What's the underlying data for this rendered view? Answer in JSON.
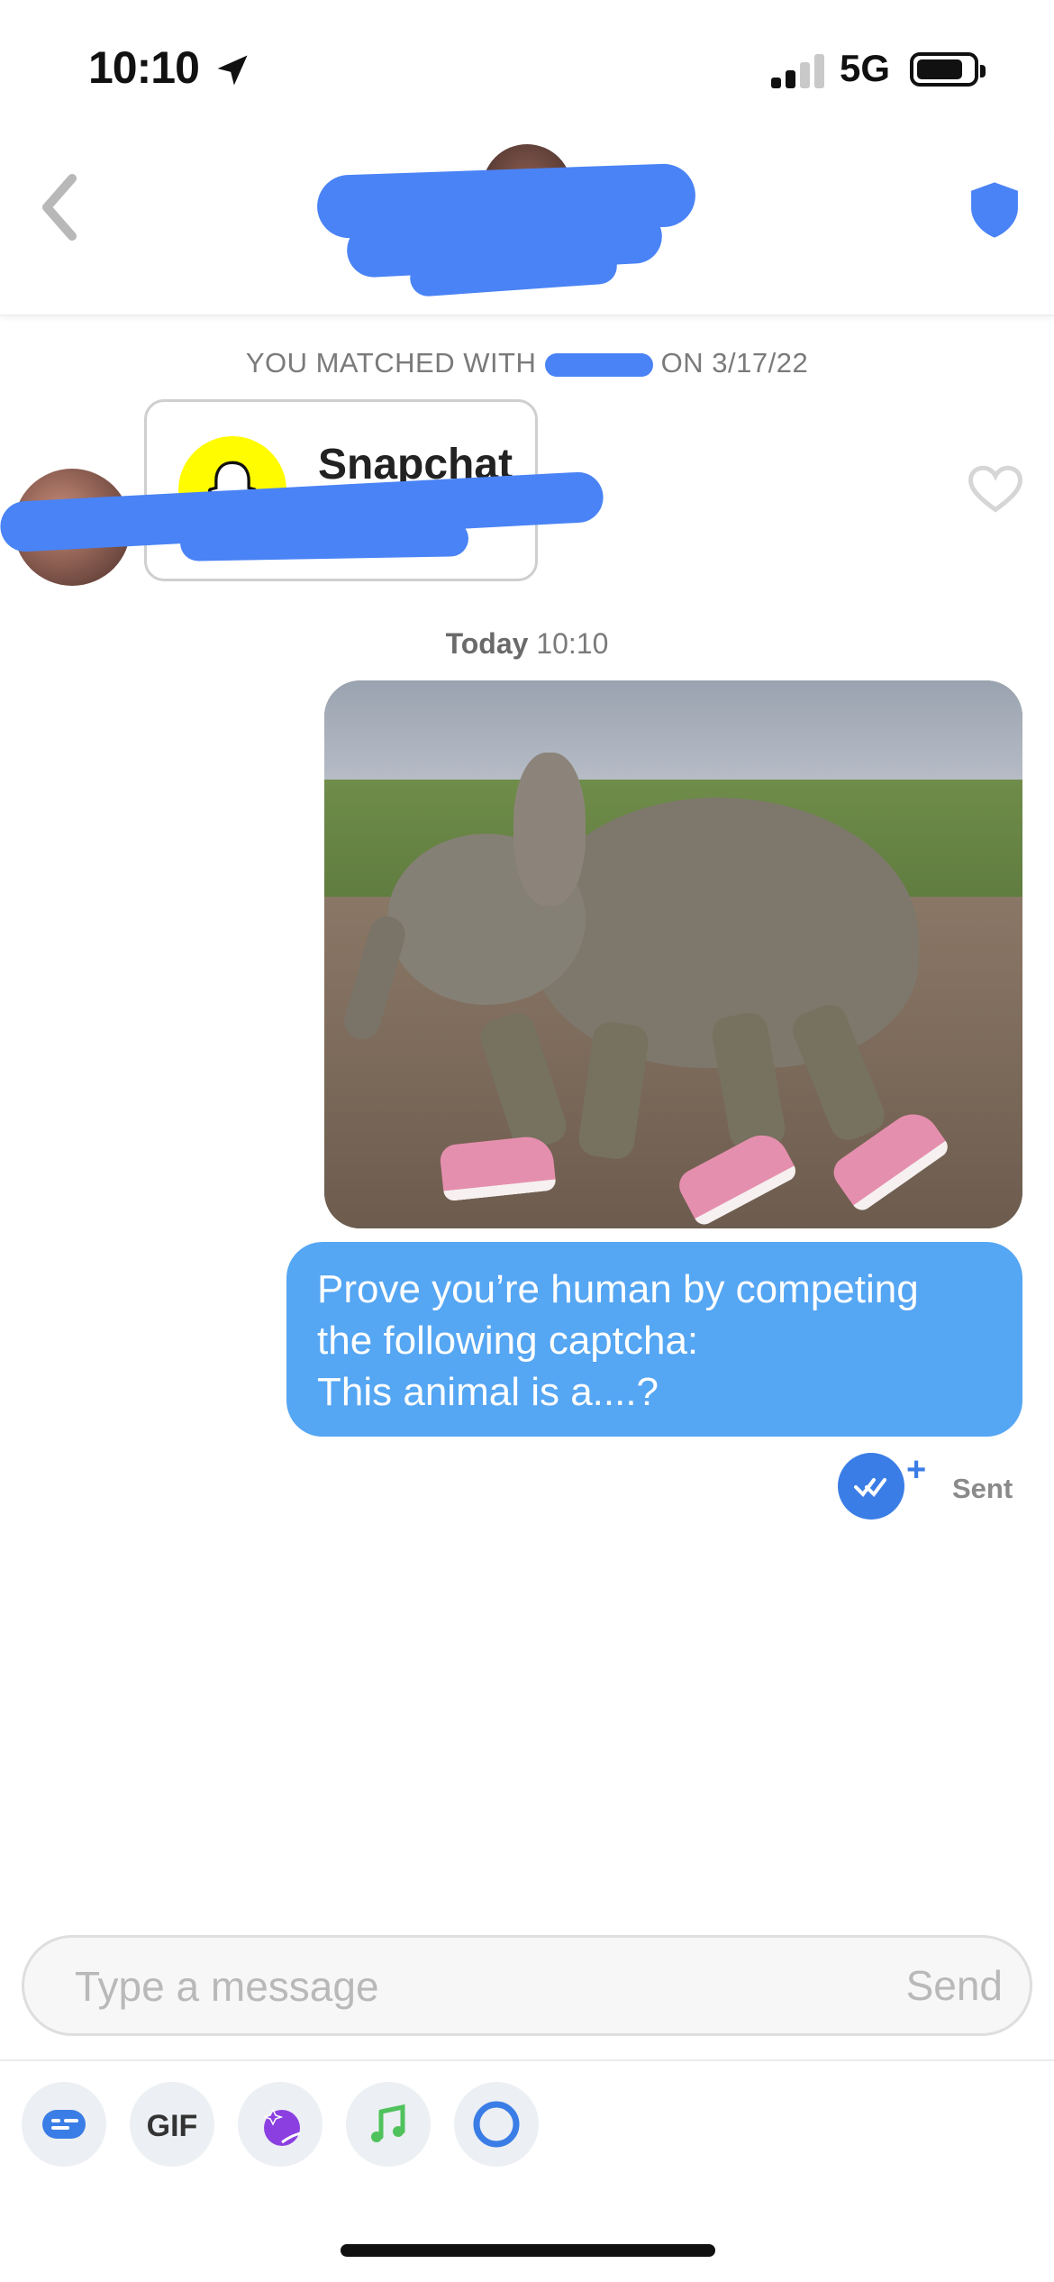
{
  "status_bar": {
    "time": "10:10",
    "network": "5G"
  },
  "header": {
    "back_icon": "chevron-left-icon",
    "safety_icon": "shield-icon"
  },
  "match": {
    "text_before": "YOU MATCHED WITH",
    "text_after": "ON 3/17/22"
  },
  "shared_card": {
    "label": "Snapchat",
    "logo_color": "#fffc00"
  },
  "conversation": {
    "date_day": "Today",
    "date_time": "10:10",
    "message_lines": [
      "Prove you’re human by competing",
      "the following captcha:",
      "This animal is a....?"
    ],
    "status": "Sent",
    "read_plus": "+"
  },
  "composer": {
    "placeholder": "Type a message",
    "send_label": "Send"
  },
  "toolbar": {
    "gif_label": "GIF"
  },
  "colors": {
    "accent_blue": "#3b7de6",
    "bubble_blue": "#55a6f3",
    "redaction_blue": "#4a83f5"
  }
}
